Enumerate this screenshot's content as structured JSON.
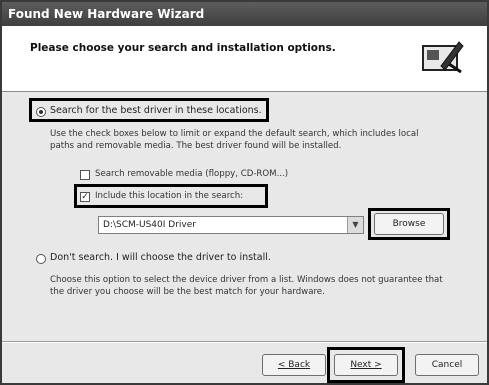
{
  "window": {
    "title": "Found New Hardware Wizard"
  },
  "header": {
    "title": "Please choose your search and installation options.",
    "icon": "hardware-wizard-icon"
  },
  "options": {
    "search_label": "Search for the best driver in these locations.",
    "search_desc_line1": "Use the check boxes below to limit or expand the default search, which includes local",
    "search_desc_line2": "paths and removable media. The best driver found will be installed.",
    "removable_label": "Search removable media (floppy, CD-ROM...)",
    "include_label": "Include this location in the search:",
    "location_value": "D:\\SCM-US40I Driver",
    "browse_label": "Browse",
    "dont_search_label": "Don't search. I will choose the driver to install.",
    "dont_desc_line1": "Choose this option to select the device driver from a list. Windows does not guarantee that",
    "dont_desc_line2": "the driver you choose will be the best match for your hardware."
  },
  "footer": {
    "back_label": "< Back",
    "next_label": "Next >",
    "cancel_label": "Cancel"
  }
}
